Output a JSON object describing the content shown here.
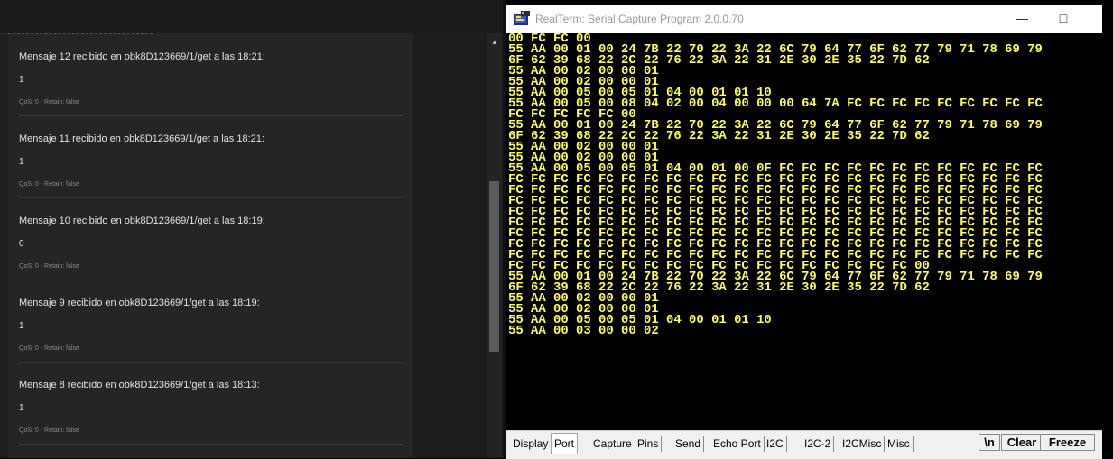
{
  "mqtt": {
    "messages": [
      {
        "title": "Mensaje 12 recibido en obk8D123669/1/get a las 18:21:",
        "value": "1",
        "meta": "QoS: 0 - Retain: false"
      },
      {
        "title": "Mensaje 11 recibido en obk8D123669/1/get a las 18:21:",
        "value": "1",
        "meta": "QoS: 0 - Retain: false"
      },
      {
        "title": "Mensaje 10 recibido en obk8D123669/1/get a las 18:19:",
        "value": "0",
        "meta": "QoS: 0 - Retain: false"
      },
      {
        "title": "Mensaje 9 recibido en obk8D123669/1/get a las 18:19:",
        "value": "1",
        "meta": "QoS: 0 - Retain: false"
      },
      {
        "title": "Mensaje 8 recibido en obk8D123669/1/get a las 18:13:",
        "value": "1",
        "meta": "QoS: 0 - Retain: false"
      }
    ],
    "scroll_up_icon": "triangle-up"
  },
  "realterm": {
    "title": "RealTerm: Serial Capture Program 2.0.0.70",
    "icons": {
      "app": "realterm-icon",
      "minimize": "minimize-icon",
      "maximize": "maximize-icon"
    },
    "terminal_color": "#ffff52",
    "lines": [
      "00 FC FC 00",
      "55 AA 00 01 00 24 7B 22 70 22 3A 22 6C 79 64 77 6F 62 77 79 71 78 69 79",
      "6F 62 39 68 22 2C 22 76 22 3A 22 31 2E 30 2E 35 22 7D 62",
      "55 AA 00 02 00 00 01",
      "55 AA 00 02 00 00 01",
      "55 AA 00 05 00 05 01 04 00 01 01 10",
      "55 AA 00 05 00 08 04 02 00 04 00 00 00 64 7A FC FC FC FC FC FC FC FC FC",
      "FC FC FC FC FC 00",
      "55 AA 00 01 00 24 7B 22 70 22 3A 22 6C 79 64 77 6F 62 77 79 71 78 69 79",
      "6F 62 39 68 22 2C 22 76 22 3A 22 31 2E 30 2E 35 22 7D 62",
      "55 AA 00 02 00 00 01",
      "55 AA 00 02 00 00 01",
      "55 AA 00 05 00 05 01 04 00 01 00 0F FC FC FC FC FC FC FC FC FC FC FC FC",
      "FC FC FC FC FC FC FC FC FC FC FC FC FC FC FC FC FC FC FC FC FC FC FC FC",
      "FC FC FC FC FC FC FC FC FC FC FC FC FC FC FC FC FC FC FC FC FC FC FC FC",
      "FC FC FC FC FC FC FC FC FC FC FC FC FC FC FC FC FC FC FC FC FC FC FC FC",
      "FC FC FC FC FC FC FC FC FC FC FC FC FC FC FC FC FC FC FC FC FC FC FC FC",
      "FC FC FC FC FC FC FC FC FC FC FC FC FC FC FC FC FC FC FC FC FC FC FC FC",
      "FC FC FC FC FC FC FC FC FC FC FC FC FC FC FC FC FC FC FC FC FC FC FC FC",
      "FC FC FC FC FC FC FC FC FC FC FC FC FC FC FC FC FC FC FC FC FC FC FC FC",
      "FC FC FC FC FC FC FC FC FC FC FC FC FC FC FC FC FC FC FC FC FC FC FC FC",
      "FC FC FC FC FC FC FC FC FC FC FC FC FC FC FC FC FC FC 00",
      "55 AA 00 01 00 24 7B 22 70 22 3A 22 6C 79 64 77 6F 62 77 79 71 78 69 79",
      "6F 62 39 68 22 2C 22 76 22 3A 22 31 2E 30 2E 35 22 7D 62",
      "55 AA 00 02 00 00 01",
      "55 AA 00 02 00 00 01",
      "55 AA 00 05 00 05 01 04 00 01 01 10",
      "55 AA 00 03 00 00 02"
    ],
    "tabs": [
      "Display",
      "Port",
      "Capture",
      "Pins",
      "Send",
      "Echo Port",
      "I2C",
      "I2C-2",
      "I2CMisc",
      "Misc"
    ],
    "active_tab": "Port",
    "buttons": {
      "newline": "\\n",
      "clear": "Clear",
      "freeze": "Freeze"
    }
  }
}
